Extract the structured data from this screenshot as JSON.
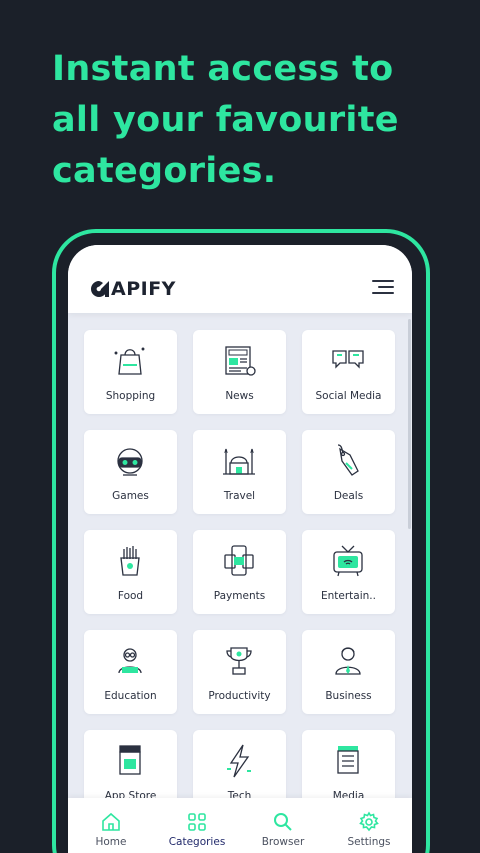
{
  "headline": "Instant access to all your favourite categories.",
  "app": {
    "logo_text": "APIFY",
    "accent_color": "#2ee6a0",
    "background_color": "#1b2029"
  },
  "categories": [
    {
      "label": "Shopping",
      "icon": "shopping-bag-icon"
    },
    {
      "label": "News",
      "icon": "newspaper-icon"
    },
    {
      "label": "Social Media",
      "icon": "speech-bubbles-icon"
    },
    {
      "label": "Games",
      "icon": "vr-headset-icon"
    },
    {
      "label": "Travel",
      "icon": "mosque-icon"
    },
    {
      "label": "Deals",
      "icon": "price-tag-icon"
    },
    {
      "label": "Food",
      "icon": "fries-icon"
    },
    {
      "label": "Payments",
      "icon": "mobile-payment-icon"
    },
    {
      "label": "Entertain..",
      "icon": "television-icon"
    },
    {
      "label": "Education",
      "icon": "student-icon"
    },
    {
      "label": "Productivity",
      "icon": "trophy-icon"
    },
    {
      "label": "Business",
      "icon": "businessman-icon"
    },
    {
      "label": "App Store",
      "icon": "store-icon"
    },
    {
      "label": "Tech",
      "icon": "lightning-icon"
    },
    {
      "label": "Media",
      "icon": "film-icon"
    }
  ],
  "nav": {
    "home": "Home",
    "categories": "Categories",
    "browser": "Browser",
    "settings": "Settings",
    "active": "categories"
  }
}
